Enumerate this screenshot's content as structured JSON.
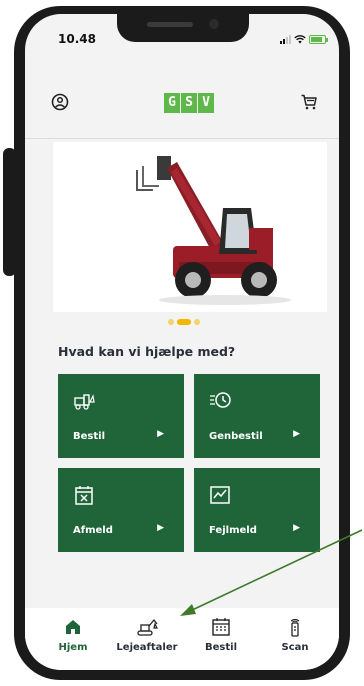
{
  "status_bar": {
    "time": "10.48"
  },
  "header": {
    "profile_icon": "user-circle-icon",
    "cart_icon": "cart-icon",
    "logo_letters": [
      "G",
      "S",
      "V"
    ],
    "logo_color": "#5fb84a"
  },
  "banner": {
    "image": "telehandler-machine"
  },
  "carousel": {
    "total": 3,
    "active_index": 1
  },
  "section": {
    "title": "Hvad kan vi hjælpe med?"
  },
  "tiles": [
    {
      "label": "Bestil",
      "icon": "truck-order-icon"
    },
    {
      "label": "Genbestil",
      "icon": "clock-reorder-icon"
    },
    {
      "label": "Afmeld",
      "icon": "calendar-cancel-icon"
    },
    {
      "label": "Fejlmeld",
      "icon": "chart-report-icon"
    }
  ],
  "bottom_nav": {
    "active": "Hjem",
    "items": [
      {
        "label": "Hjem",
        "icon": "home-icon"
      },
      {
        "label": "Lejeaftaler",
        "icon": "excavator-icon"
      },
      {
        "label": "Bestil",
        "icon": "calendar-icon"
      },
      {
        "label": "Scan",
        "icon": "scan-remote-icon"
      }
    ]
  },
  "colors": {
    "primary": "#20653a",
    "accent": "#f0b800",
    "annotation": "#3f7a2a"
  }
}
